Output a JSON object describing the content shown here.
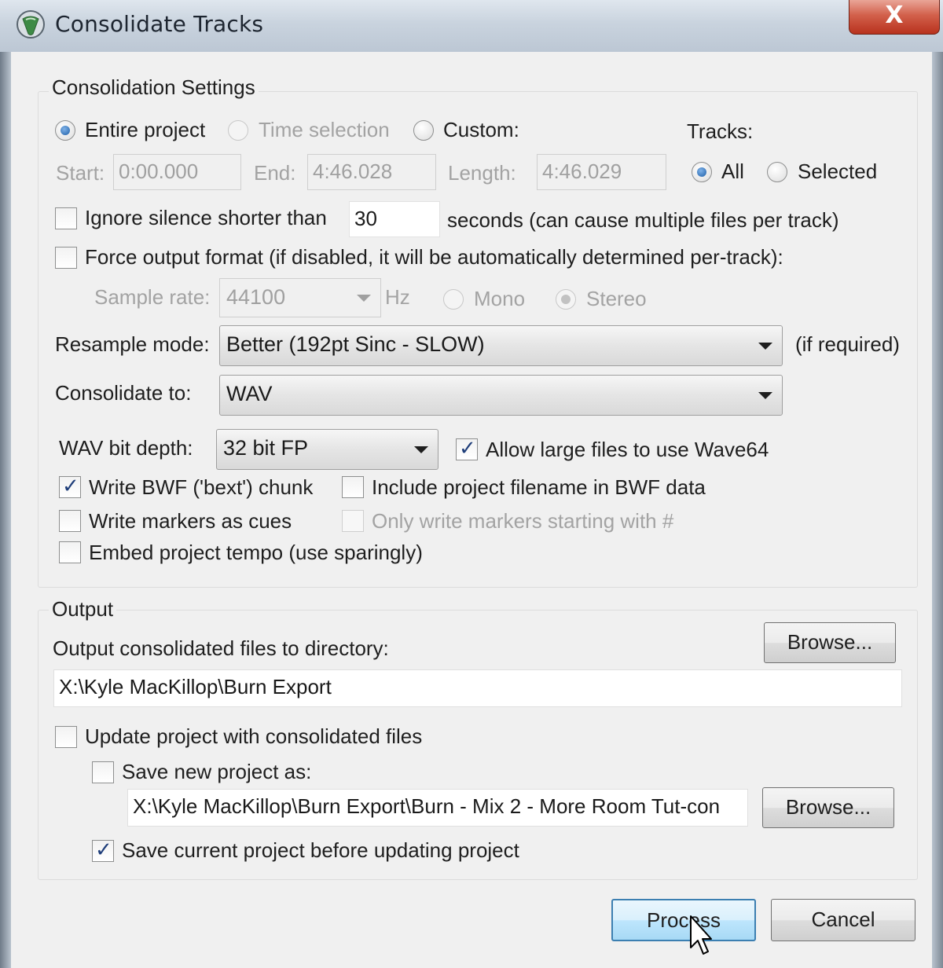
{
  "window": {
    "title": "Consolidate Tracks",
    "close_label": "X"
  },
  "settings": {
    "group_title": "Consolidation Settings",
    "range": {
      "entire_project": "Entire project",
      "time_selection": "Time selection",
      "custom": "Custom:",
      "selected": "entire_project"
    },
    "start_label": "Start:",
    "start_value": "0:00.000",
    "end_label": "End:",
    "end_value": "4:46.028",
    "length_label": "Length:",
    "length_value": "4:46.029",
    "tracks_label": "Tracks:",
    "tracks_all": "All",
    "tracks_selected": "Selected",
    "tracks_choice": "all",
    "ignore_silence_label": "Ignore silence shorter than",
    "ignore_silence_value": "30",
    "ignore_silence_suffix": "seconds (can cause multiple files per track)",
    "ignore_silence_checked": false,
    "force_format_label": "Force output format (if disabled, it will be automatically determined per-track):",
    "force_format_checked": false,
    "sample_rate_label": "Sample rate:",
    "sample_rate_value": "44100",
    "hz_label": "Hz",
    "mono_label": "Mono",
    "stereo_label": "Stereo",
    "resample_label": "Resample mode:",
    "resample_value": "Better (192pt Sinc - SLOW)",
    "resample_suffix": "(if required)",
    "consolidate_to_label": "Consolidate to:",
    "consolidate_to_value": "WAV",
    "wav_bit_depth_label": "WAV bit depth:",
    "wav_bit_depth_value": "32 bit FP",
    "allow_wave64_label": "Allow large files to use Wave64",
    "allow_wave64_checked": true,
    "write_bwf_label": "Write BWF ('bext') chunk",
    "write_bwf_checked": true,
    "include_filename_label": "Include project filename in BWF data",
    "include_filename_checked": false,
    "write_markers_label": "Write markers as cues",
    "write_markers_checked": false,
    "only_markers_label": "Only write markers starting with #",
    "embed_tempo_label": "Embed project tempo (use sparingly)",
    "embed_tempo_checked": false
  },
  "output": {
    "group_title": "Output",
    "directory_label": "Output consolidated files to directory:",
    "browse_label": "Browse...",
    "directory_value": "X:\\Kyle MacKillop\\Burn Export",
    "update_project_label": "Update project with consolidated files",
    "update_project_checked": false,
    "save_new_label": "Save new project as:",
    "save_new_checked": false,
    "save_new_value": "X:\\Kyle MacKillop\\Burn Export\\Burn - Mix 2 - More Room  Tut-con",
    "browse2_label": "Browse...",
    "save_current_label": "Save current project before updating project",
    "save_current_checked": true
  },
  "buttons": {
    "process": "Process",
    "cancel": "Cancel"
  }
}
